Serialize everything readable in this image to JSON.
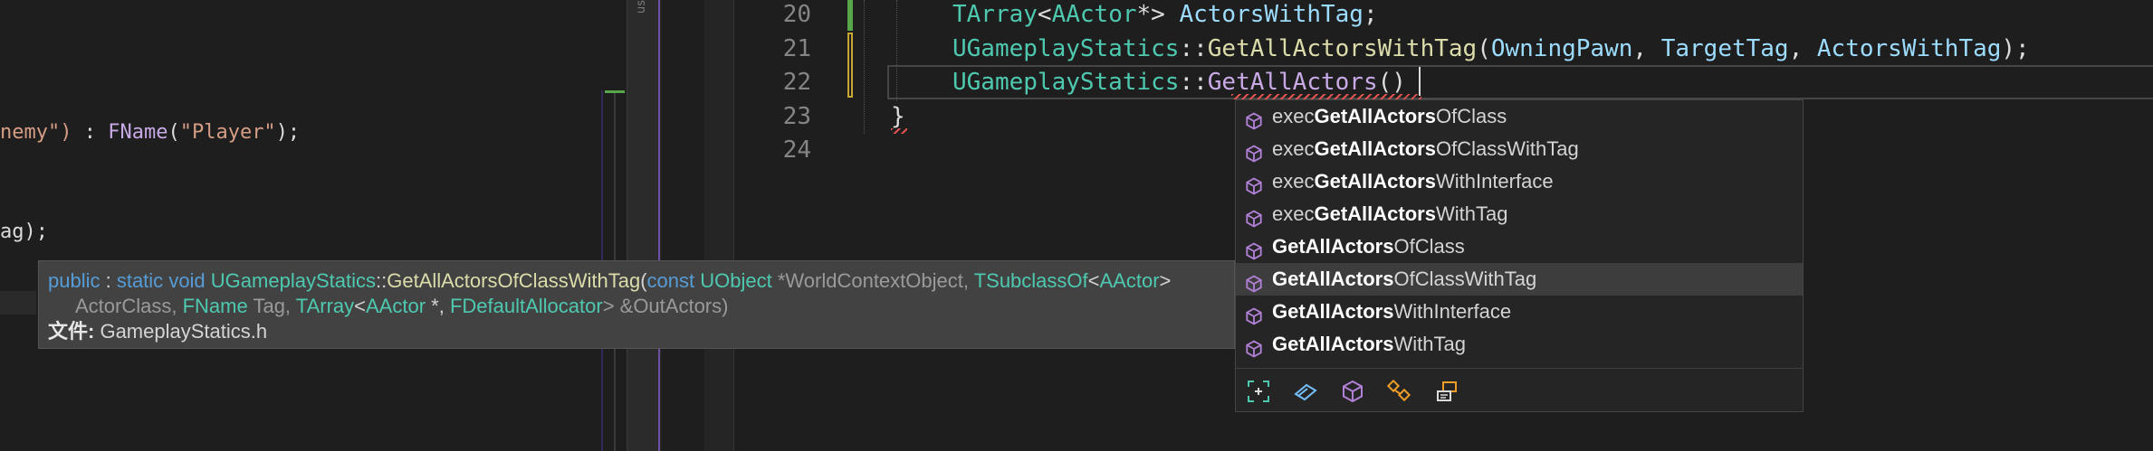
{
  "left_pane": {
    "line_a": {
      "str1": "nemy\")",
      "sep": " : ",
      "fn": "FName",
      "open": "(",
      "str2": "\"Player\"",
      "close": ");"
    },
    "line_b": "ag);"
  },
  "split_bar": {
    "vlabel": "us"
  },
  "editor": {
    "lines": [
      {
        "num": "20",
        "tokens": [
          {
            "t": "TArray",
            "c": "type"
          },
          {
            "t": "<",
            "c": "pun"
          },
          {
            "t": "AActor",
            "c": "type"
          },
          {
            "t": "*> ",
            "c": "pun"
          },
          {
            "t": "ActorsWithTag",
            "c": "var"
          },
          {
            "t": ";",
            "c": "pun"
          }
        ]
      },
      {
        "num": "21",
        "tokens": [
          {
            "t": "UGameplayStatics",
            "c": "type"
          },
          {
            "t": "::",
            "c": "pun"
          },
          {
            "t": "GetAllActorsWithTag",
            "c": "fn"
          },
          {
            "t": "(",
            "c": "pun"
          },
          {
            "t": "OwningPawn",
            "c": "var"
          },
          {
            "t": ", ",
            "c": "pun"
          },
          {
            "t": "TargetTag",
            "c": "var"
          },
          {
            "t": ", ",
            "c": "pun"
          },
          {
            "t": "ActorsWithTag",
            "c": "var"
          },
          {
            "t": ");",
            "c": "pun"
          }
        ]
      },
      {
        "num": "22",
        "tokens": [
          {
            "t": "UGameplayStatics",
            "c": "type"
          },
          {
            "t": "::",
            "c": "pun"
          },
          {
            "t": "GetAllActors",
            "c": "fnm"
          },
          {
            "t": "()",
            "c": "pun"
          }
        ]
      },
      {
        "num": "23",
        "tokens": [
          {
            "t": "}",
            "c": "pun"
          }
        ]
      },
      {
        "num": "24",
        "tokens": []
      }
    ]
  },
  "tooltip": {
    "kw_public": "public",
    "colon": " : ",
    "kw_static": "static",
    "kw_void": "void",
    "cls": "UGameplayStatics",
    "scope": "::",
    "fn": "GetAllActorsOfClassWithTag",
    "paren": "(",
    "kw_const": "const",
    "t_uobject": "UObject",
    "p1": "*WorldContextObject,",
    "t_tsubclass": "TSubclassOf",
    "lt": "<",
    "t_aactor": "AActor",
    "gt": ">",
    "p2": "ActorClass,",
    "t_fname": "FName",
    "p3": "Tag,",
    "t_tarray": "TArray",
    "t_aactor2": "AActor",
    "star": " *, ",
    "t_alloc": "FDefaultAllocator",
    "p4": "> &OutActors)",
    "file_label": "文件:",
    "file_name": "GameplayStatics.h"
  },
  "autocomplete": {
    "items": [
      {
        "pre": "exec",
        "bold": "GetAllActors",
        "post": "OfClass"
      },
      {
        "pre": "exec",
        "bold": "GetAllActors",
        "post": "OfClassWithTag"
      },
      {
        "pre": "exec",
        "bold": "GetAllActors",
        "post": "WithInterface"
      },
      {
        "pre": "exec",
        "bold": "GetAllActors",
        "post": "WithTag"
      },
      {
        "pre": "",
        "bold": "GetAllActors",
        "post": "OfClass"
      },
      {
        "pre": "",
        "bold": "GetAllActors",
        "post": "OfClassWithTag"
      },
      {
        "pre": "",
        "bold": "GetAllActors",
        "post": "WithInterface"
      },
      {
        "pre": "",
        "bold": "GetAllActors",
        "post": "WithTag"
      }
    ],
    "selected_index": 5,
    "filter_icons": [
      "select-all-icon",
      "enum-icon",
      "method-icon",
      "class-icon",
      "snippet-icon"
    ]
  },
  "colors": {
    "method_icon": "#b180d7",
    "selected_bg": "#3d3d3d",
    "accent_green": "#57a64a",
    "accent_yellow": "#c8a632"
  }
}
